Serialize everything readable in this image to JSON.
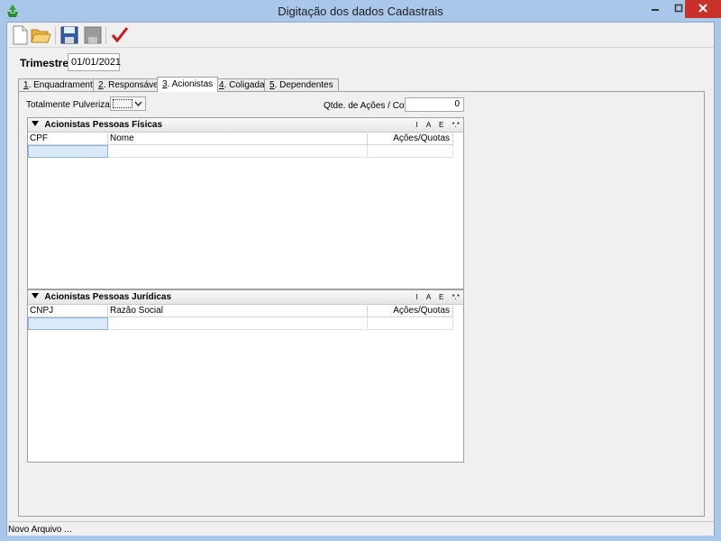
{
  "window": {
    "title": "Digitação dos dados Cadastrais"
  },
  "toolbar": {
    "buttons": [
      {
        "icon": "new-document-icon"
      },
      {
        "icon": "open-folder-icon"
      },
      {
        "icon": "save-floppy-icon"
      },
      {
        "icon": "save-disabled-icon"
      },
      {
        "icon": "checkmark-icon"
      }
    ]
  },
  "trimestre": {
    "label": "Trimestre",
    "value": "01/01/2021"
  },
  "tabs": [
    {
      "num": "1",
      "label": ". Enquadramento",
      "active": false
    },
    {
      "num": "2",
      "label": ". Responsáveis",
      "active": false
    },
    {
      "num": "3",
      "label": ". Acionistas",
      "active": true
    },
    {
      "num": "4",
      "label": ". Coligadas",
      "active": false
    },
    {
      "num": "5",
      "label": ". Dependentes",
      "active": false
    }
  ],
  "form": {
    "pulverizado_label": "Totalmente Pulverizado",
    "qtde_label": "Qtde. de Ações / Cotas",
    "qtde_value": "0"
  },
  "grid_pf": {
    "title": "Acionistas Pessoas Físicas",
    "actions": [
      "I",
      "A",
      "E",
      "*.*"
    ],
    "columns": [
      "CPF",
      "Nome",
      "Ações/Quotas"
    ]
  },
  "grid_pj": {
    "title": "Acionistas Pessoas Jurídicas",
    "actions": [
      "I",
      "A",
      "E",
      "*.*"
    ],
    "columns": [
      "CNPJ",
      "Razão Social",
      "Ações/Quotas"
    ]
  },
  "status": {
    "text": "Novo Arquivo ..."
  },
  "colors": {
    "frame": "#a9c7e8",
    "close_button": "#c7312a",
    "selected_cell": "#dbeaf9",
    "check_red": "#d01818"
  }
}
